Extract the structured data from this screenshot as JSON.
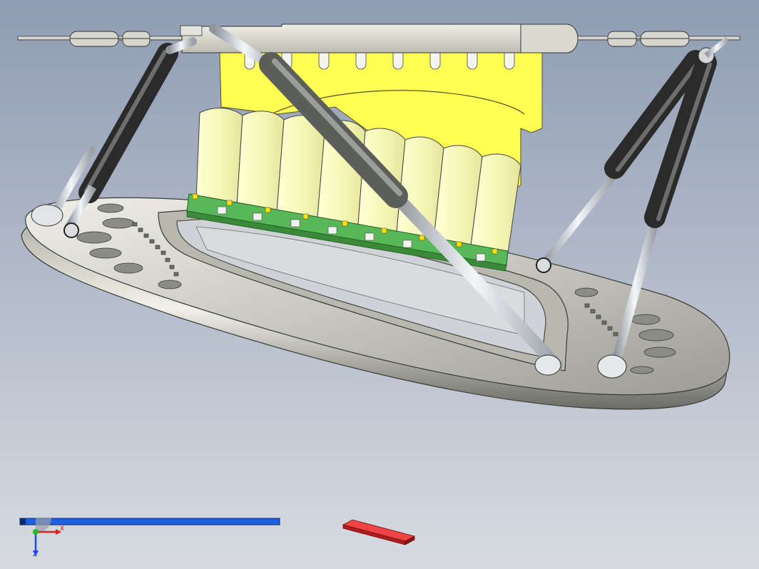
{
  "viewport": {
    "background_top": "#8f9cb3",
    "background_bottom": "#d7dbe1",
    "colors": {
      "metal_light": "#e6e6dc",
      "metal_mid": "#bdbdb4",
      "metal_dark": "#5c5c58",
      "cylinder_dark": "#3c3d3c",
      "rod_silver": "#d8dde2",
      "yellow_block": "#ffff55",
      "cream_segments": "#fbfcc8",
      "green_strip": "#58b858",
      "accent_yellow": "#ffe000"
    },
    "model": {
      "parts": [
        "upper-plate",
        "lower-base-ring",
        "gas-spring",
        "yellow-fixture-block",
        "cream-segments",
        "green-hinge-strip"
      ],
      "gas_spring_count": 4
    }
  },
  "triad": {
    "x_label": "X",
    "z_label": "Z",
    "x_color": "#dd2222",
    "y_color": "#22bb22",
    "z_color": "#2244ff"
  },
  "status": {
    "progress_bar_color": "#1e5fe0",
    "marker_color": "#d8272a"
  }
}
